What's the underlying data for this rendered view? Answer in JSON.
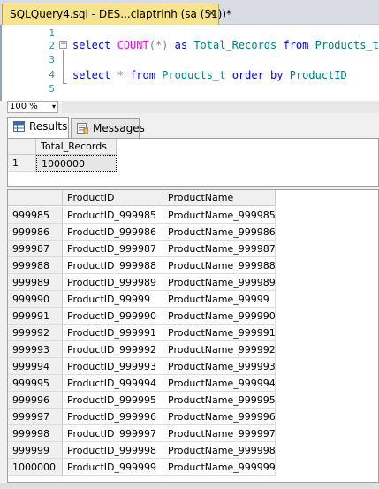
{
  "tab": {
    "title": "SQLQuery4.sql - DES...claptrinh (sa (51))*",
    "close": "✕"
  },
  "editor": {
    "line_numbers": [
      "1",
      "2",
      "3",
      "4",
      "5"
    ],
    "line2": {
      "kw1": "select",
      "fn": "COUNT",
      "op": "(*)",
      "kw2": "as",
      "id1": "Total_Records",
      "kw3": "from",
      "id2": "Products_t"
    },
    "line4": {
      "kw1": "select",
      "op": "*",
      "kw2": "from",
      "id1": "Products_t",
      "kw3": "order by",
      "id2": "ProductID"
    },
    "fold_symbol": "−"
  },
  "zoom": {
    "value": "100 %",
    "arrow": "▾"
  },
  "results_tabs": [
    {
      "label": "Results",
      "icon": "grid-icon"
    },
    {
      "label": "Messages",
      "icon": "messages-icon"
    }
  ],
  "grid1": {
    "columns": [
      "Total_Records"
    ],
    "rows": [
      {
        "num": "1",
        "values": [
          "1000000"
        ]
      }
    ]
  },
  "grid2": {
    "columns": [
      "ProductID",
      "ProductName"
    ],
    "rows": [
      {
        "num": "999985",
        "values": [
          "ProductID_999985",
          "ProductName_999985"
        ]
      },
      {
        "num": "999986",
        "values": [
          "ProductID_999986",
          "ProductName_999986"
        ]
      },
      {
        "num": "999987",
        "values": [
          "ProductID_999987",
          "ProductName_999987"
        ]
      },
      {
        "num": "999988",
        "values": [
          "ProductID_999988",
          "ProductName_999988"
        ]
      },
      {
        "num": "999989",
        "values": [
          "ProductID_999989",
          "ProductName_999989"
        ]
      },
      {
        "num": "999990",
        "values": [
          "ProductID_99999",
          "ProductName_99999"
        ]
      },
      {
        "num": "999991",
        "values": [
          "ProductID_999990",
          "ProductName_999990"
        ]
      },
      {
        "num": "999992",
        "values": [
          "ProductID_999991",
          "ProductName_999991"
        ]
      },
      {
        "num": "999993",
        "values": [
          "ProductID_999992",
          "ProductName_999992"
        ]
      },
      {
        "num": "999994",
        "values": [
          "ProductID_999993",
          "ProductName_999993"
        ]
      },
      {
        "num": "999995",
        "values": [
          "ProductID_999994",
          "ProductName_999994"
        ]
      },
      {
        "num": "999996",
        "values": [
          "ProductID_999995",
          "ProductName_999995"
        ]
      },
      {
        "num": "999997",
        "values": [
          "ProductID_999996",
          "ProductName_999996"
        ]
      },
      {
        "num": "999998",
        "values": [
          "ProductID_999997",
          "ProductName_999997"
        ]
      },
      {
        "num": "999999",
        "values": [
          "ProductID_999998",
          "ProductName_999998"
        ]
      },
      {
        "num": "1000000",
        "values": [
          "ProductID_999999",
          "ProductName_999999"
        ]
      }
    ]
  }
}
